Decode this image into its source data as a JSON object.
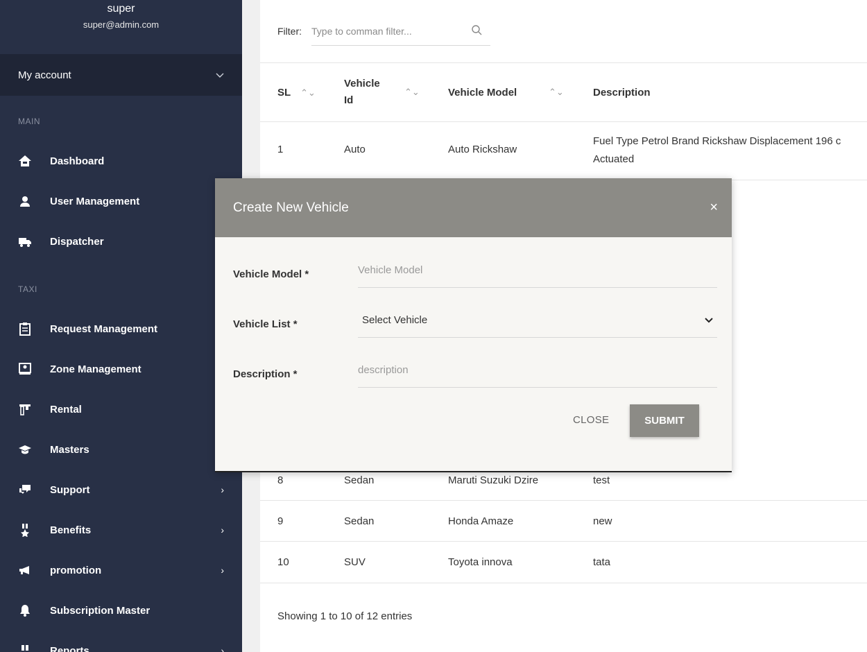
{
  "sidebar": {
    "user_name": "super",
    "user_email": "super@admin.com",
    "account_label": "My account",
    "sections": {
      "main": "MAIN",
      "taxi": "TAXI"
    },
    "items": [
      {
        "label": "Dashboard",
        "icon": "home-icon"
      },
      {
        "label": "User Management",
        "icon": "user-icon"
      },
      {
        "label": "Dispatcher",
        "icon": "truck-icon"
      },
      {
        "label": "Request Management",
        "icon": "clipboard-icon"
      },
      {
        "label": "Zone Management",
        "icon": "map-pin-icon"
      },
      {
        "label": "Rental",
        "icon": "rental-icon"
      },
      {
        "label": "Masters",
        "icon": "graduation-cap-icon"
      },
      {
        "label": "Support",
        "icon": "chat-icon"
      },
      {
        "label": "Benefits",
        "icon": "medal-icon"
      },
      {
        "label": "promotion",
        "icon": "megaphone-icon"
      },
      {
        "label": "Subscription Master",
        "icon": "bell-icon"
      },
      {
        "label": "Reports",
        "icon": "report-icon"
      }
    ]
  },
  "filter": {
    "label": "Filter:",
    "placeholder": "Type to comman filter..."
  },
  "table": {
    "headers": [
      "SL",
      "Vehicle Id",
      "Vehicle Model",
      "Description"
    ],
    "rows": [
      {
        "sl": "1",
        "vehicle_id": "Auto",
        "model": "Auto Rickshaw",
        "description": "Fuel Type Petrol Brand Rickshaw Displacement 196 c",
        "description_2": "Actuated"
      },
      {
        "sl": "8",
        "vehicle_id": "Sedan",
        "model": "Maruti Suzuki Dzire",
        "description": "test"
      },
      {
        "sl": "9",
        "vehicle_id": "Sedan",
        "model": "Honda Amaze",
        "description": "new"
      },
      {
        "sl": "10",
        "vehicle_id": "SUV",
        "model": "Toyota innova",
        "description": "tata"
      }
    ],
    "footer": "Showing 1 to 10 of 12 entries"
  },
  "modal": {
    "title": "Create New Vehicle",
    "fields": [
      {
        "label": "Vehicle Model *",
        "placeholder": "Vehicle Model"
      },
      {
        "label": "Vehicle List *",
        "value": "Select Vehicle"
      },
      {
        "label": "Description *",
        "placeholder": "description"
      }
    ],
    "close_label": "CLOSE",
    "submit_label": "SUBMIT"
  },
  "colors": {
    "sidebar_bg": "#283046",
    "modal_header": "#8c8b86"
  }
}
